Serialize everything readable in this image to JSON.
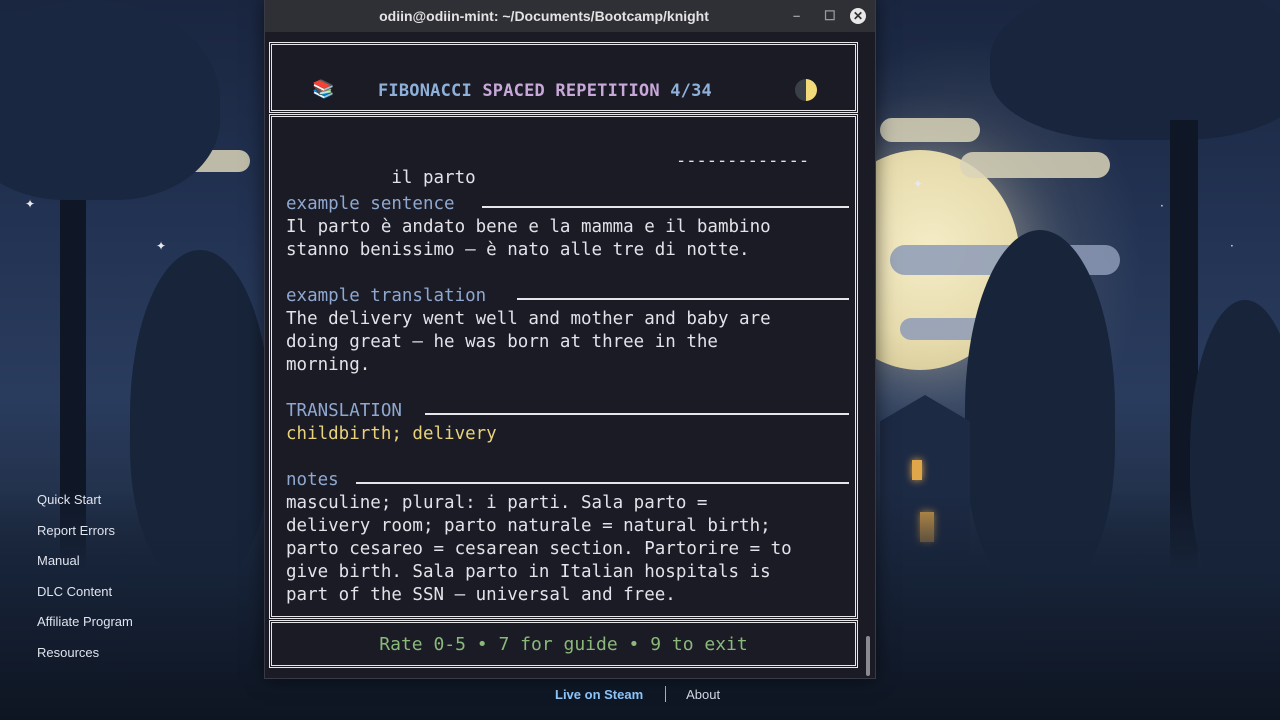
{
  "window": {
    "title": "odiin@odiin-mint: ~/Documents/Bootcamp/knight",
    "minimize_glyph": "–",
    "maximize_glyph": "☐",
    "close_glyph": "✕"
  },
  "header": {
    "icon": "books-emoji",
    "books_glyph": "📚",
    "title_part1": "FIBONACCI",
    "title_part2": "SPACED",
    "title_part3": "REPETITION",
    "progress": "4/34",
    "theme_icon": "half-moon-icon"
  },
  "card": {
    "article": "il",
    "word": "parto",
    "hidden_marker": "-------------",
    "example_sentence": {
      "label": "example sentence",
      "lines": [
        "Il parto è andato bene e la mamma e il bambino",
        "stanno benissimo — è nato alle tre di notte."
      ]
    },
    "example_translation": {
      "label": "example translation",
      "lines": [
        "The delivery went well and mother and baby are",
        "doing great — he was born at three in the",
        "morning."
      ]
    },
    "translation": {
      "label": "TRANSLATION",
      "value": "childbirth; delivery"
    },
    "notes": {
      "label": "notes",
      "lines": [
        "masculine; plural: i parti. Sala parto =",
        "delivery room; parto naturale = natural birth;",
        "parto cesareo = cesarean section. Partorire = to",
        "give birth. Sala parto in Italian hospitals is",
        "part of the SSN — universal and free."
      ]
    }
  },
  "footer": {
    "hint": "Rate 0-5 • 7 for guide • 9 to exit"
  },
  "side_menu": [
    "Quick Start",
    "Report Errors",
    "Manual",
    "DLC Content",
    "Affiliate Program",
    "Resources"
  ],
  "bottom_links": {
    "steam": "Live on Steam",
    "about": "About"
  },
  "colors": {
    "terminal_bg": "#1b1b26",
    "accent_blue": "#8fb0d8",
    "translation_yellow": "#e8d27a",
    "footer_green": "#8ab97a"
  }
}
